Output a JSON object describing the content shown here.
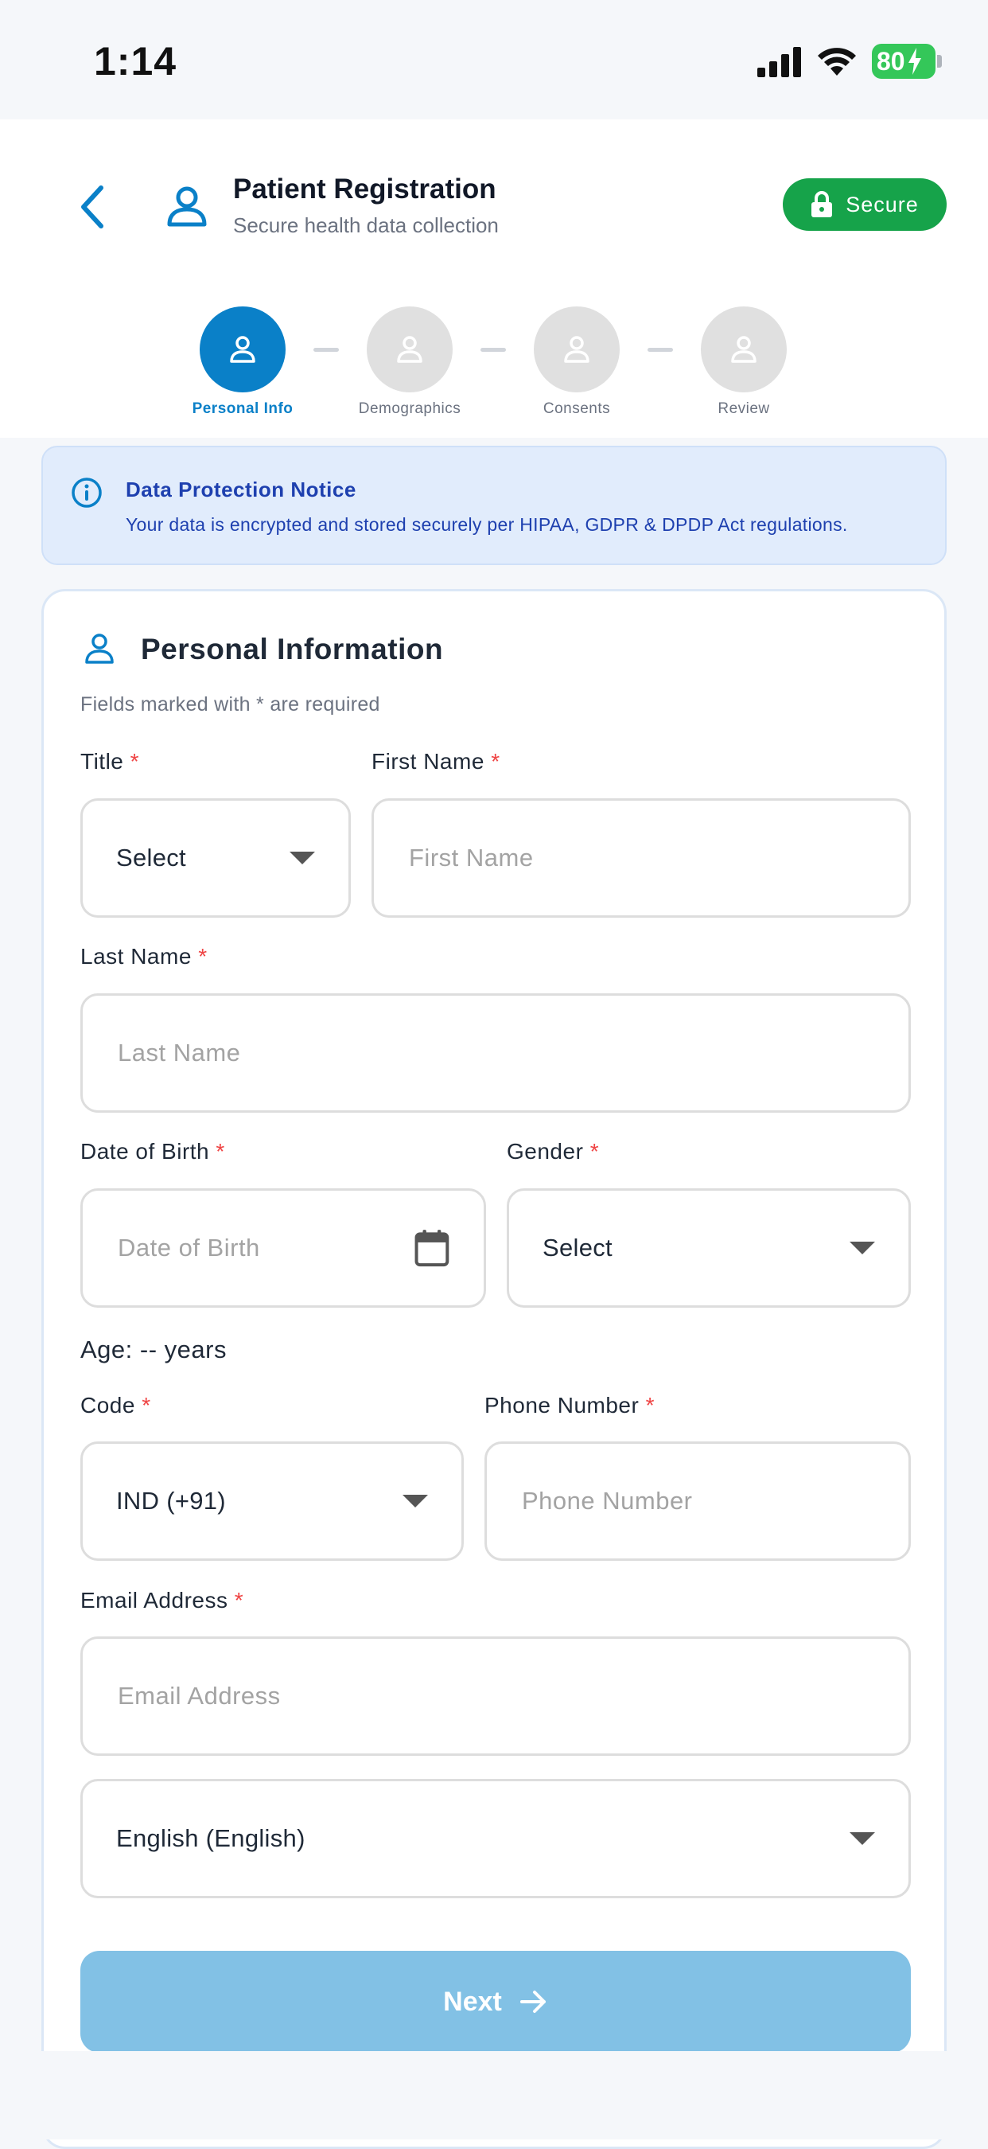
{
  "status_bar": {
    "time": "1:14",
    "battery": "80"
  },
  "header": {
    "title": "Patient Registration",
    "subtitle": "Secure health data collection",
    "secure_label": "Secure"
  },
  "stepper": {
    "steps": [
      {
        "label": "Personal Info",
        "active": true
      },
      {
        "label": "Demographics",
        "active": false
      },
      {
        "label": "Consents",
        "active": false
      },
      {
        "label": "Review",
        "active": false
      }
    ]
  },
  "notice": {
    "title": "Data Protection Notice",
    "text": "Your data is encrypted and stored securely per HIPAA, GDPR & DPDP Act regulations."
  },
  "form": {
    "title": "Personal Information",
    "subtitle": "Fields marked with * are required",
    "required_mark": "*",
    "title_field": {
      "label": "Title",
      "value": "Select"
    },
    "first_name": {
      "label": "First Name",
      "placeholder": "First Name"
    },
    "last_name": {
      "label": "Last Name",
      "placeholder": "Last Name"
    },
    "dob": {
      "label": "Date of Birth",
      "placeholder": "Date of Birth"
    },
    "gender": {
      "label": "Gender",
      "value": "Select"
    },
    "age_text": "Age: -- years",
    "code": {
      "label": "Code",
      "value": "IND (+91)"
    },
    "phone": {
      "label": "Phone Number",
      "placeholder": "Phone Number"
    },
    "email": {
      "label": "Email Address",
      "placeholder": "Email Address"
    },
    "language": {
      "value": "English (English)"
    },
    "next_label": "Next"
  },
  "colors": {
    "primary": "#0a80c8",
    "secure_green": "#16a34a",
    "required_red": "#ef4444",
    "notice_bg": "#e1ecfc",
    "next_button": "#82c1e5"
  }
}
